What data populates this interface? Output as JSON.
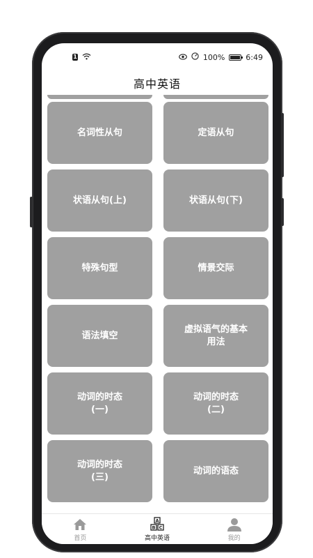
{
  "status": {
    "time": "6:49",
    "battery": "100%",
    "sim_badge": "1"
  },
  "header": {
    "title": "高中英语"
  },
  "cards": [
    {
      "label": "名词性从句"
    },
    {
      "label": "定语从句"
    },
    {
      "label": "状语从句(上)"
    },
    {
      "label": "状语从句(下)"
    },
    {
      "label": "特殊句型"
    },
    {
      "label": "情景交际"
    },
    {
      "label": "语法填空"
    },
    {
      "label": "虚拟语气的基本\n用法"
    },
    {
      "label": "动词的时态\n(一)"
    },
    {
      "label": "动词的时态\n(二)"
    },
    {
      "label": "动词的时态\n(三)"
    },
    {
      "label": "动词的语态"
    }
  ],
  "tabs": [
    {
      "label": "首页",
      "icon": "home-icon"
    },
    {
      "label": "高中英语",
      "icon": "abc-blocks-icon",
      "active": true
    },
    {
      "label": "我的",
      "icon": "person-icon"
    }
  ],
  "colors": {
    "card_bg": "#a0a0a0",
    "active_tab": "#222222",
    "inactive_tab": "#9a9a9a"
  }
}
